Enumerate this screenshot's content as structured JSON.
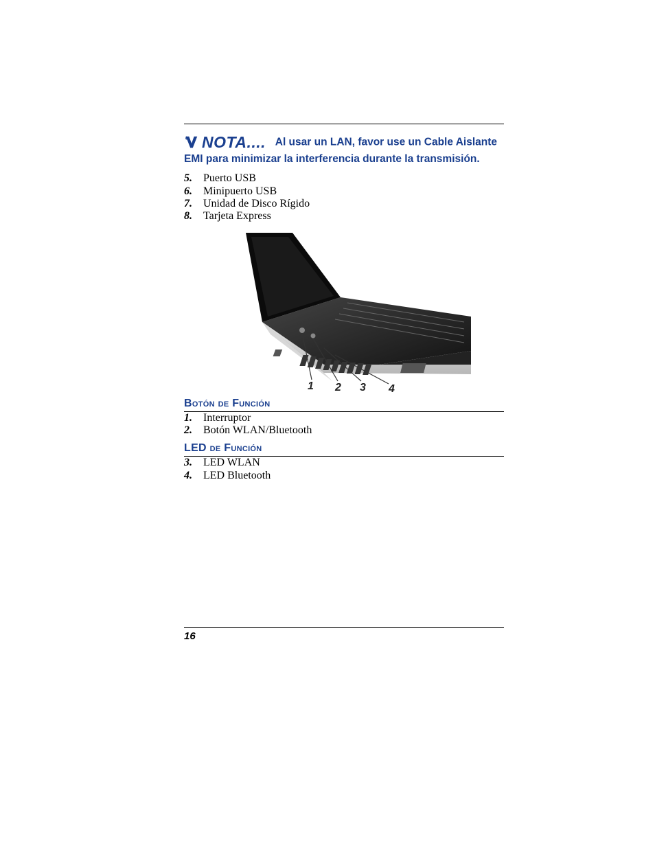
{
  "note": {
    "label": "NOTA....",
    "text": "Al usar un LAN, favor use un Cable Aislante EMI para minimizar la interferencia durante la transmisión."
  },
  "topList": [
    {
      "n": "5.",
      "label": "Puerto USB"
    },
    {
      "n": "6.",
      "label": "Minipuerto USB"
    },
    {
      "n": "7.",
      "label": "Unidad de Disco Rígido"
    },
    {
      "n": "8.",
      "label": "Tarjeta Express"
    }
  ],
  "figure": {
    "markers": [
      "1",
      "2",
      "3",
      "4"
    ]
  },
  "sections": [
    {
      "heading": "Botón de Función",
      "items": [
        {
          "n": "1.",
          "label": "Interruptor"
        },
        {
          "n": "2.",
          "label": "Botón WLAN/Bluetooth"
        }
      ]
    },
    {
      "heading": "LED de Función",
      "items": [
        {
          "n": "3.",
          "label": "LED WLAN"
        },
        {
          "n": "4.",
          "label": "LED Bluetooth"
        }
      ]
    }
  ],
  "pageNumber": "16"
}
